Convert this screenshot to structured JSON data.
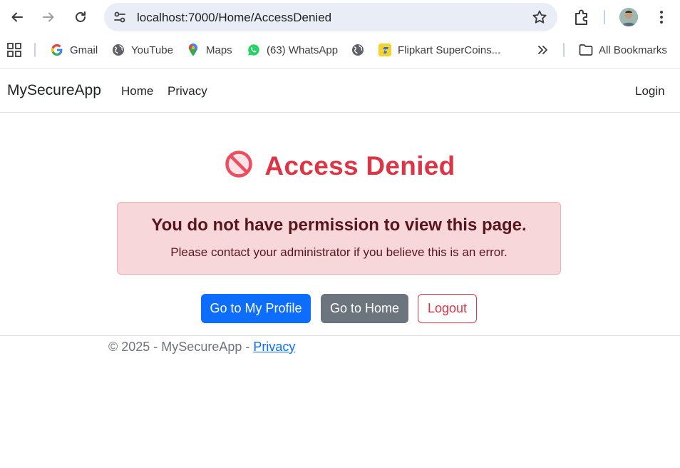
{
  "browser": {
    "url_host": "localhost:7000",
    "url_path": "/Home/AccessDenied",
    "bookmarks": [
      {
        "label": "Gmail",
        "icon": "gmail-icon"
      },
      {
        "label": "YouTube",
        "icon": "globe-icon"
      },
      {
        "label": "Maps",
        "icon": "maps-icon"
      },
      {
        "label": "(63) WhatsApp",
        "icon": "whatsapp-icon"
      },
      {
        "label": "",
        "icon": "globe-icon"
      },
      {
        "label": "Flipkart SuperCoins...",
        "icon": "flipkart-icon"
      }
    ],
    "all_bookmarks_label": "All Bookmarks"
  },
  "navbar": {
    "brand": "MySecureApp",
    "links": [
      "Home",
      "Privacy"
    ],
    "login": "Login"
  },
  "main": {
    "title": "Access Denied",
    "alert_heading": "You do not have permission to view this page.",
    "alert_text": "Please contact your administrator if you believe this is an error.",
    "buttons": {
      "profile": "Go to My Profile",
      "home": "Go to Home",
      "logout": "Logout"
    }
  },
  "footer": {
    "text": "© 2025 - MySecureApp - ",
    "link": "Privacy"
  },
  "colors": {
    "danger": "#dc3545",
    "primary": "#0d6efd",
    "secondary": "#6c757d",
    "alert_bg": "#f8d7da"
  }
}
